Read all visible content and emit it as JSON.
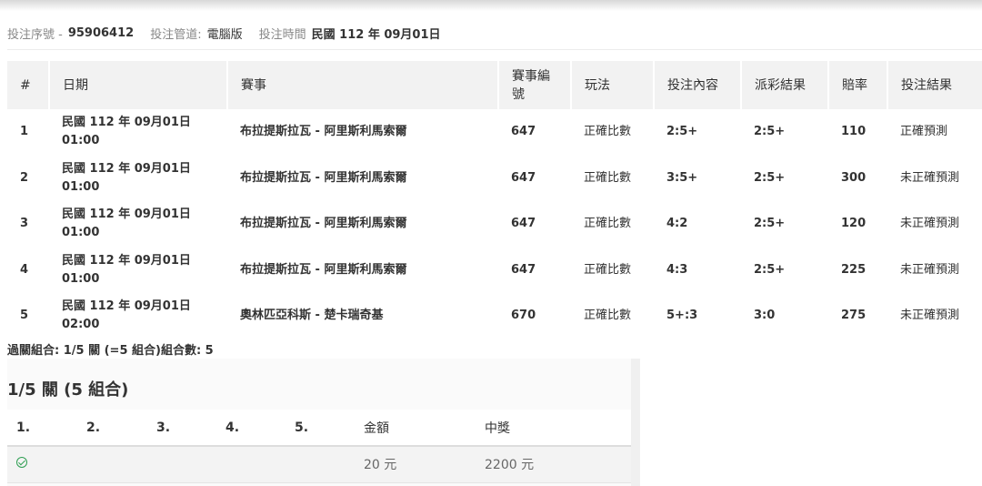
{
  "info": {
    "serial_label": "投注序號 -",
    "serial_value": "95906412",
    "channel_label": "投注管道:",
    "channel_value": "電腦版",
    "time_label": "投注時間",
    "time_value": "民國 112 年 09月01日"
  },
  "table": {
    "headers": [
      "#",
      "日期",
      "賽事",
      "賽事編號",
      "玩法",
      "投注內容",
      "派彩結果",
      "賠率",
      "投注結果"
    ],
    "rows": [
      {
        "num": "1",
        "date": "民國 112 年 09月01日",
        "time": "01:00",
        "match": "布拉提斯拉瓦 - 阿里斯利馬索爾",
        "code": "647",
        "play": "正確比數",
        "bet": "2:5+",
        "payout": "2:5+",
        "odds": "110",
        "result": "正確預測"
      },
      {
        "num": "2",
        "date": "民國 112 年 09月01日",
        "time": "01:00",
        "match": "布拉提斯拉瓦 - 阿里斯利馬索爾",
        "code": "647",
        "play": "正確比數",
        "bet": "3:5+",
        "payout": "2:5+",
        "odds": "300",
        "result": "未正確預測"
      },
      {
        "num": "3",
        "date": "民國 112 年 09月01日",
        "time": "01:00",
        "match": "布拉提斯拉瓦 - 阿里斯利馬索爾",
        "code": "647",
        "play": "正確比數",
        "bet": "4:2",
        "payout": "2:5+",
        "odds": "120",
        "result": "未正確預測"
      },
      {
        "num": "4",
        "date": "民國 112 年 09月01日",
        "time": "01:00",
        "match": "布拉提斯拉瓦 - 阿里斯利馬索爾",
        "code": "647",
        "play": "正確比數",
        "bet": "4:3",
        "payout": "2:5+",
        "odds": "225",
        "result": "未正確預測"
      },
      {
        "num": "5",
        "date": "民國 112 年 09月01日",
        "time": "02:00",
        "match": "奧林匹亞科斯 - 楚卡瑞奇基",
        "code": "670",
        "play": "正確比數",
        "bet": "5+:3",
        "payout": "3:0",
        "odds": "275",
        "result": "未正確預測"
      }
    ]
  },
  "summary": "過關組合: 1/5 關 (=5 組合)組合數: 5",
  "combo": {
    "title": "1/5 關 (5 組合)",
    "headers": [
      "1.",
      "2.",
      "3.",
      "4.",
      "5.",
      "金額",
      "中獎"
    ],
    "row": {
      "icon": "check-circle-icon",
      "amount": "20 元",
      "prize": "2200 元"
    }
  },
  "colors": {
    "header_bg": "#f2f2f2",
    "check": "#2e9e52"
  }
}
